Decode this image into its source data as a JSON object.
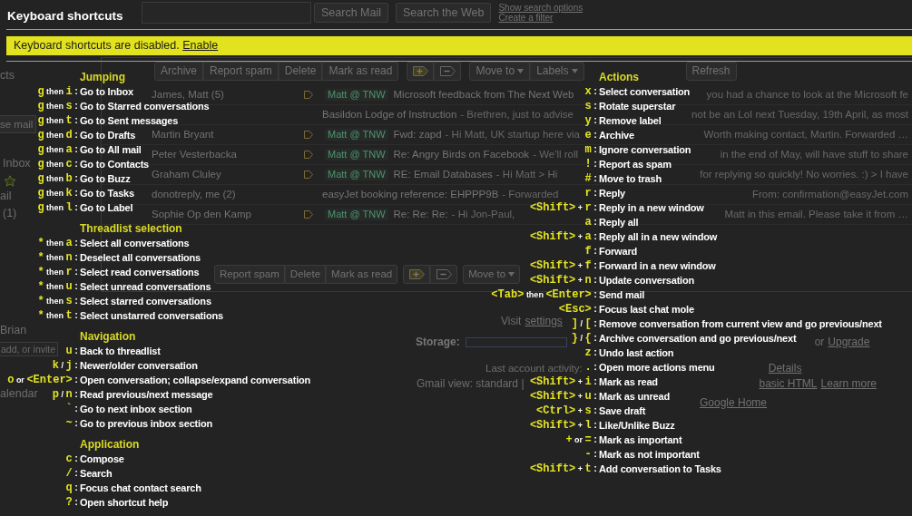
{
  "gmail": {
    "search": {
      "buttons": [
        "Search Mail",
        "Search the Web"
      ],
      "links": [
        "Show search options",
        "Create a filter"
      ]
    },
    "sidebar": [
      {
        "kind": "text",
        "text": "cts"
      },
      {
        "kind": "button",
        "text": "se mail"
      },
      {
        "kind": "text",
        "text": "Inbox"
      },
      {
        "kind": "star"
      },
      {
        "kind": "text",
        "text": "ail"
      },
      {
        "kind": "text",
        "text": "(1)"
      },
      {
        "kind": "text",
        "text": "Brian"
      },
      {
        "kind": "field",
        "placeholder": "add, or invite"
      },
      {
        "kind": "text",
        "text": "alendar"
      }
    ],
    "toolbar": [
      [
        {
          "kind": "button",
          "label": "Archive"
        },
        {
          "kind": "button",
          "label": "Report spam"
        },
        {
          "kind": "button",
          "label": "Delete"
        },
        {
          "kind": "button",
          "label": "Mark as read"
        }
      ],
      [
        {
          "kind": "label_add"
        },
        {
          "kind": "label_remove"
        }
      ],
      [
        {
          "kind": "menu",
          "label": "Move to"
        },
        {
          "kind": "menu",
          "label": "Labels"
        }
      ],
      [
        {
          "kind": "button",
          "label": "Refresh"
        }
      ]
    ],
    "emails": [
      {
        "sender": "James, Matt (5)",
        "tag": "Matt @ TNW",
        "subject": "Microsoft feedback from The Next Web",
        "snippet_end": "you had a chance to look at the Microsoft fe"
      },
      {
        "subject": "Basildon Lodge of Instruction",
        "snippet": "- Brethren, just to advise",
        "snippet_end": "not be an LoI next Tuesday, 19th April, as most"
      },
      {
        "sender": "Martin Bryant",
        "tag": "Matt @ TNW",
        "subject": "Fwd: zapd",
        "snippet": "- Hi Matt, UK startup here via",
        "snippet_end": "Worth making contact, Martin. Forwarded …"
      },
      {
        "sender": "Peter Vesterbacka",
        "tag": "Matt @ TNW",
        "subject": "Re: Angry Birds on Facebook",
        "snippet": "- We'll roll",
        "snippet_end": "in the end of May, will have stuff to share"
      },
      {
        "sender": "Graham Cluley",
        "tag": "Matt @ TNW",
        "subject": "RE: Email Databases",
        "snippet": "- Hi Matt > Hi",
        "snippet_end": "for replying so quickly! No worries. :) > I have"
      },
      {
        "sender": "donotreply, me (2)",
        "subject": "easyJet booking reference: EHPPP9B",
        "snippet": "- Forwarded",
        "snippet_end": "From: confirmation@easyJet.com"
      },
      {
        "sender": "Sophie Op den Kamp",
        "tag": "Matt @ TNW",
        "subject": "Re: Re: Re:",
        "snippet": "- Hi Jon-Paul,",
        "snippet_end": "Matt in this email. Please take it from …"
      }
    ],
    "toolbar_bottom": [
      [
        {
          "kind": "button",
          "label": "Report spam"
        },
        {
          "kind": "button",
          "label": "Delete"
        },
        {
          "kind": "button",
          "label": "Mark as read"
        }
      ],
      [
        {
          "kind": "label_add"
        },
        {
          "kind": "label_remove"
        }
      ],
      [
        {
          "kind": "menu",
          "label": "Move to"
        }
      ]
    ],
    "footer": {
      "settings_hint": {
        "text": "Visit",
        "link": "settings"
      },
      "storage": {
        "label": "Storage:",
        "joiner": "or",
        "link": "Upgrade"
      },
      "activity": {
        "text": "Last account activity:",
        "link": "Details"
      },
      "view": {
        "text": "Gmail view: standard |",
        "links": [
          "basic HTML",
          "Learn more"
        ]
      },
      "home_link": "Google Home"
    }
  },
  "shortcuts": {
    "title": "Keyboard shortcuts",
    "notice": {
      "text": "Keyboard shortcuts are disabled.",
      "link": "Enable"
    },
    "separator": ":",
    "columns": [
      {
        "sections": [
          {
            "heading": "Jumping",
            "items": [
              {
                "keys": [
                  "g",
                  "i"
                ],
                "joiner": "then",
                "action": "Go to Inbox"
              },
              {
                "keys": [
                  "g",
                  "s"
                ],
                "joiner": "then",
                "action": "Go to Starred conversations"
              },
              {
                "keys": [
                  "g",
                  "t"
                ],
                "joiner": "then",
                "action": "Go to Sent messages"
              },
              {
                "keys": [
                  "g",
                  "d"
                ],
                "joiner": "then",
                "action": "Go to Drafts"
              },
              {
                "keys": [
                  "g",
                  "a"
                ],
                "joiner": "then",
                "action": "Go to All mail"
              },
              {
                "keys": [
                  "g",
                  "c"
                ],
                "joiner": "then",
                "action": "Go to Contacts"
              },
              {
                "keys": [
                  "g",
                  "b"
                ],
                "joiner": "then",
                "action": "Go to Buzz"
              },
              {
                "keys": [
                  "g",
                  "k"
                ],
                "joiner": "then",
                "action": "Go to Tasks"
              },
              {
                "keys": [
                  "g",
                  "l"
                ],
                "joiner": "then",
                "action": "Go to Label"
              }
            ]
          },
          {
            "heading": "Threadlist selection",
            "items": [
              {
                "keys": [
                  "*",
                  "a"
                ],
                "joiner": "then",
                "action": "Select all conversations"
              },
              {
                "keys": [
                  "*",
                  "n"
                ],
                "joiner": "then",
                "action": "Deselect all conversations"
              },
              {
                "keys": [
                  "*",
                  "r"
                ],
                "joiner": "then",
                "action": "Select read conversations"
              },
              {
                "keys": [
                  "*",
                  "u"
                ],
                "joiner": "then",
                "action": "Select unread conversations"
              },
              {
                "keys": [
                  "*",
                  "s"
                ],
                "joiner": "then",
                "action": "Select starred conversations"
              },
              {
                "keys": [
                  "*",
                  "t"
                ],
                "joiner": "then",
                "action": "Select unstarred conversations"
              }
            ]
          },
          {
            "heading": "Navigation",
            "items": [
              {
                "keys": [
                  "u"
                ],
                "action": "Back to threadlist"
              },
              {
                "keys": [
                  "k",
                  "j"
                ],
                "joiner": "/",
                "action": "Newer/older conversation"
              },
              {
                "keys": [
                  "o",
                  "<Enter>"
                ],
                "joiner": "or",
                "action": "Open conversation; collapse/expand conversation"
              },
              {
                "keys": [
                  "p",
                  "n"
                ],
                "joiner": "/",
                "action": "Read previous/next message"
              },
              {
                "keys": [
                  "`"
                ],
                "action": "Go to next inbox section"
              },
              {
                "keys": [
                  "~"
                ],
                "action": "Go to previous inbox section"
              }
            ]
          },
          {
            "heading": "Application",
            "items": [
              {
                "keys": [
                  "c"
                ],
                "action": "Compose"
              },
              {
                "keys": [
                  "/"
                ],
                "action": "Search"
              },
              {
                "keys": [
                  "q"
                ],
                "action": "Focus chat contact search"
              },
              {
                "keys": [
                  "?"
                ],
                "action": "Open shortcut help"
              }
            ]
          }
        ]
      },
      {
        "sections": [
          {
            "heading": "Actions",
            "items": [
              {
                "keys": [
                  "x"
                ],
                "action": "Select conversation"
              },
              {
                "keys": [
                  "s"
                ],
                "action": "Rotate superstar"
              },
              {
                "keys": [
                  "y"
                ],
                "action": "Remove label"
              },
              {
                "keys": [
                  "e"
                ],
                "action": "Archive"
              },
              {
                "keys": [
                  "m"
                ],
                "action": "Ignore conversation"
              },
              {
                "keys": [
                  "!"
                ],
                "action": "Report as spam"
              },
              {
                "keys": [
                  "#"
                ],
                "action": "Move to trash"
              },
              {
                "keys": [
                  "r"
                ],
                "action": "Reply"
              },
              {
                "keys": [
                  "<Shift>",
                  "r"
                ],
                "joiner": "+",
                "action": "Reply in a new window"
              },
              {
                "keys": [
                  "a"
                ],
                "action": "Reply all"
              },
              {
                "keys": [
                  "<Shift>",
                  "a"
                ],
                "joiner": "+",
                "action": "Reply all in a new window"
              },
              {
                "keys": [
                  "f"
                ],
                "action": "Forward"
              },
              {
                "keys": [
                  "<Shift>",
                  "f"
                ],
                "joiner": "+",
                "action": "Forward in a new window"
              },
              {
                "keys": [
                  "<Shift>",
                  "n"
                ],
                "joiner": "+",
                "action": "Update conversation"
              },
              {
                "keys": [
                  "<Tab>",
                  "<Enter>"
                ],
                "joiner": "then",
                "action": "Send mail"
              },
              {
                "keys": [
                  "<Esc>"
                ],
                "action": "Focus last chat mole"
              },
              {
                "keys": [
                  "]",
                  "["
                ],
                "joiner": "/",
                "action": "Remove conversation from current view and go previous/next"
              },
              {
                "keys": [
                  "}",
                  "{"
                ],
                "joiner": "/",
                "action": "Archive conversation and go previous/next"
              },
              {
                "keys": [
                  "z"
                ],
                "action": "Undo last action"
              },
              {
                "keys": [
                  "."
                ],
                "action": "Open more actions menu"
              },
              {
                "keys": [
                  "<Shift>",
                  "i"
                ],
                "joiner": "+",
                "action": "Mark as read"
              },
              {
                "keys": [
                  "<Shift>",
                  "u"
                ],
                "joiner": "+",
                "action": "Mark as unread"
              },
              {
                "keys": [
                  "<Ctrl>",
                  "s"
                ],
                "joiner": "+",
                "action": "Save draft"
              },
              {
                "keys": [
                  "<Shift>",
                  "l"
                ],
                "joiner": "+",
                "action": "Like/Unlike Buzz"
              },
              {
                "keys": [
                  "+",
                  "="
                ],
                "joiner": "or",
                "action": "Mark as important"
              },
              {
                "keys": [
                  "-"
                ],
                "action": "Mark as not important"
              },
              {
                "keys": [
                  "<Shift>",
                  "t"
                ],
                "joiner": "+",
                "action": "Add conversation to Tasks"
              }
            ]
          }
        ]
      }
    ]
  }
}
